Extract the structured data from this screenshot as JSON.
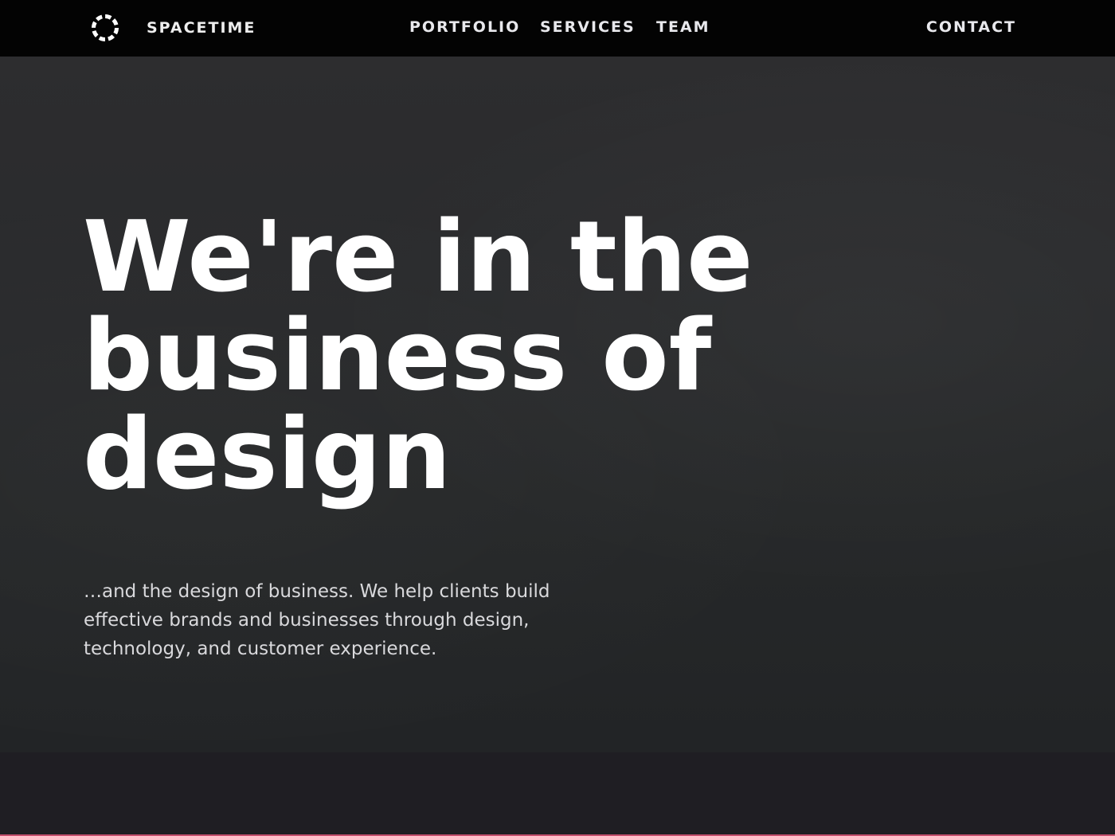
{
  "header": {
    "logo_icon": "dashed-circle-logo-icon",
    "brand": "SPACETIME",
    "nav": {
      "portfolio": "PORTFOLIO",
      "services": "SERVICES",
      "team": "TEAM",
      "contact": "CONTACT"
    }
  },
  "hero": {
    "heading": "We're in the business of design",
    "subtext": "…and the design of business. We help clients build effective brands and businesses through design, technology, and customer experience."
  },
  "colors": {
    "header_bg": "#030303",
    "hero_bg": "#2a2b2d",
    "lower_bg": "#1f1e23",
    "accent": "#c4506e",
    "text": "#ffffff"
  }
}
